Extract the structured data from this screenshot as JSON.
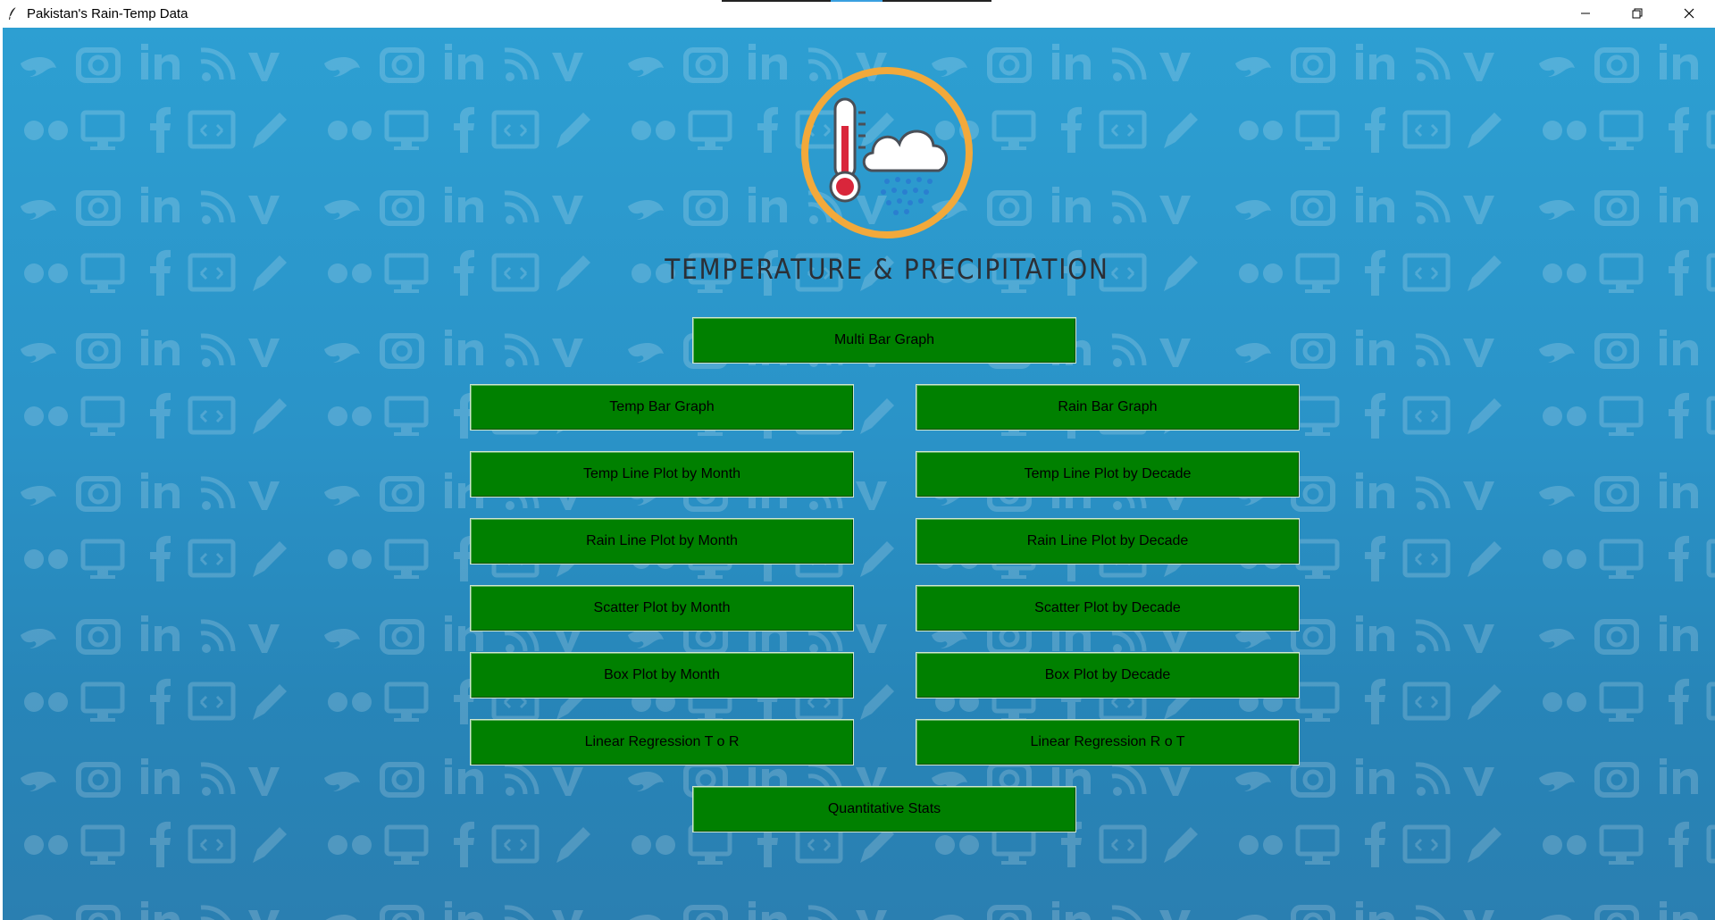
{
  "window": {
    "title": "Pakistan's Rain-Temp Data",
    "app_icon": "feather-icon",
    "controls": [
      "minimize-icon",
      "restore-icon",
      "close-icon"
    ]
  },
  "header": {
    "logo_icon": "thermometer-rain-cloud-icon",
    "title": "TEMPERATURE & PRECIPITATION"
  },
  "buttons": {
    "multi_bar": "Multi Bar Graph",
    "temp_bar": "Temp Bar Graph",
    "rain_bar": "Rain Bar Graph",
    "temp_line_month": "Temp Line Plot by Month",
    "temp_line_decade": "Temp Line Plot by Decade",
    "rain_line_month": "Rain Line Plot by Month",
    "rain_line_decade": "Rain Line Plot by Decade",
    "scatter_month": "Scatter Plot by Month",
    "scatter_decade": "Scatter Plot by Decade",
    "box_month": "Box Plot by Month",
    "box_decade": "Box Plot by Decade",
    "lin_reg_t_r": "Linear Regression T o R",
    "lin_reg_r_t": "Linear Regression R o T",
    "quant_stats": "Quantitative Stats"
  },
  "colors": {
    "button_bg": "#008000",
    "background": "#2a93c8",
    "logo_ring": "#f2a93b",
    "thermometer_red": "#d9263b",
    "rain_blue": "#2a7fd0"
  }
}
